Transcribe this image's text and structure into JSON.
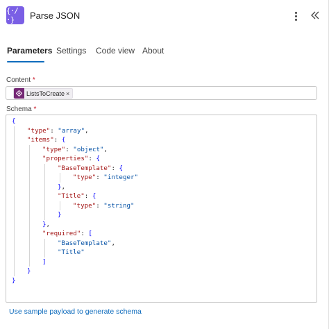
{
  "header": {
    "title": "Parse JSON",
    "action_icon_glyph": "{·/·}",
    "action_icon_color": "#7a5fe5",
    "more_icon": "more-vertical-icon",
    "collapse_icon": "double-chevron-left-icon"
  },
  "tabs": [
    {
      "label": "Parameters",
      "active": true
    },
    {
      "label": "Settings",
      "active": false
    },
    {
      "label": "Code view",
      "active": false
    },
    {
      "label": "About",
      "active": false
    }
  ],
  "content": {
    "label": "Content",
    "required_mark": "*",
    "token_label": "ListsToCreate",
    "token_remove": "×",
    "token_color": "#742774"
  },
  "schema": {
    "label": "Schema",
    "required_mark": "*",
    "lines": [
      [
        [
          "punc",
          "{"
        ]
      ],
      [
        [
          "key",
          "\"type\""
        ],
        [
          "colon",
          ": "
        ],
        [
          "str",
          "\"array\""
        ],
        [
          "colon",
          ","
        ]
      ],
      [
        [
          "key",
          "\"items\""
        ],
        [
          "colon",
          ": "
        ],
        [
          "punc",
          "{"
        ]
      ],
      [
        [
          "key",
          "\"type\""
        ],
        [
          "colon",
          ": "
        ],
        [
          "str",
          "\"object\""
        ],
        [
          "colon",
          ","
        ]
      ],
      [
        [
          "key",
          "\"properties\""
        ],
        [
          "colon",
          ": "
        ],
        [
          "punc",
          "{"
        ]
      ],
      [
        [
          "key",
          "\"BaseTemplate\""
        ],
        [
          "colon",
          ": "
        ],
        [
          "punc",
          "{"
        ]
      ],
      [
        [
          "key",
          "\"type\""
        ],
        [
          "colon",
          ": "
        ],
        [
          "str",
          "\"integer\""
        ]
      ],
      [
        [
          "punc",
          "}"
        ],
        [
          "colon",
          ","
        ]
      ],
      [
        [
          "key",
          "\"Title\""
        ],
        [
          "colon",
          ": "
        ],
        [
          "punc",
          "{"
        ]
      ],
      [
        [
          "key",
          "\"type\""
        ],
        [
          "colon",
          ": "
        ],
        [
          "str",
          "\"string\""
        ]
      ],
      [
        [
          "punc",
          "}"
        ]
      ],
      [
        [
          "punc",
          "}"
        ],
        [
          "colon",
          ","
        ]
      ],
      [
        [
          "key",
          "\"required\""
        ],
        [
          "colon",
          ": "
        ],
        [
          "punc",
          "["
        ]
      ],
      [
        [
          "str",
          "\"BaseTemplate\""
        ],
        [
          "colon",
          ","
        ]
      ],
      [
        [
          "str",
          "\"Title\""
        ]
      ],
      [
        [
          "punc",
          "]"
        ]
      ],
      [
        [
          "punc",
          "}"
        ]
      ],
      [
        [
          "punc",
          "}"
        ]
      ]
    ],
    "colors": {
      "punc": "#0000ff",
      "key": "#a31515",
      "str": "#0451a5"
    }
  },
  "sample_link": "Use sample payload to generate schema"
}
